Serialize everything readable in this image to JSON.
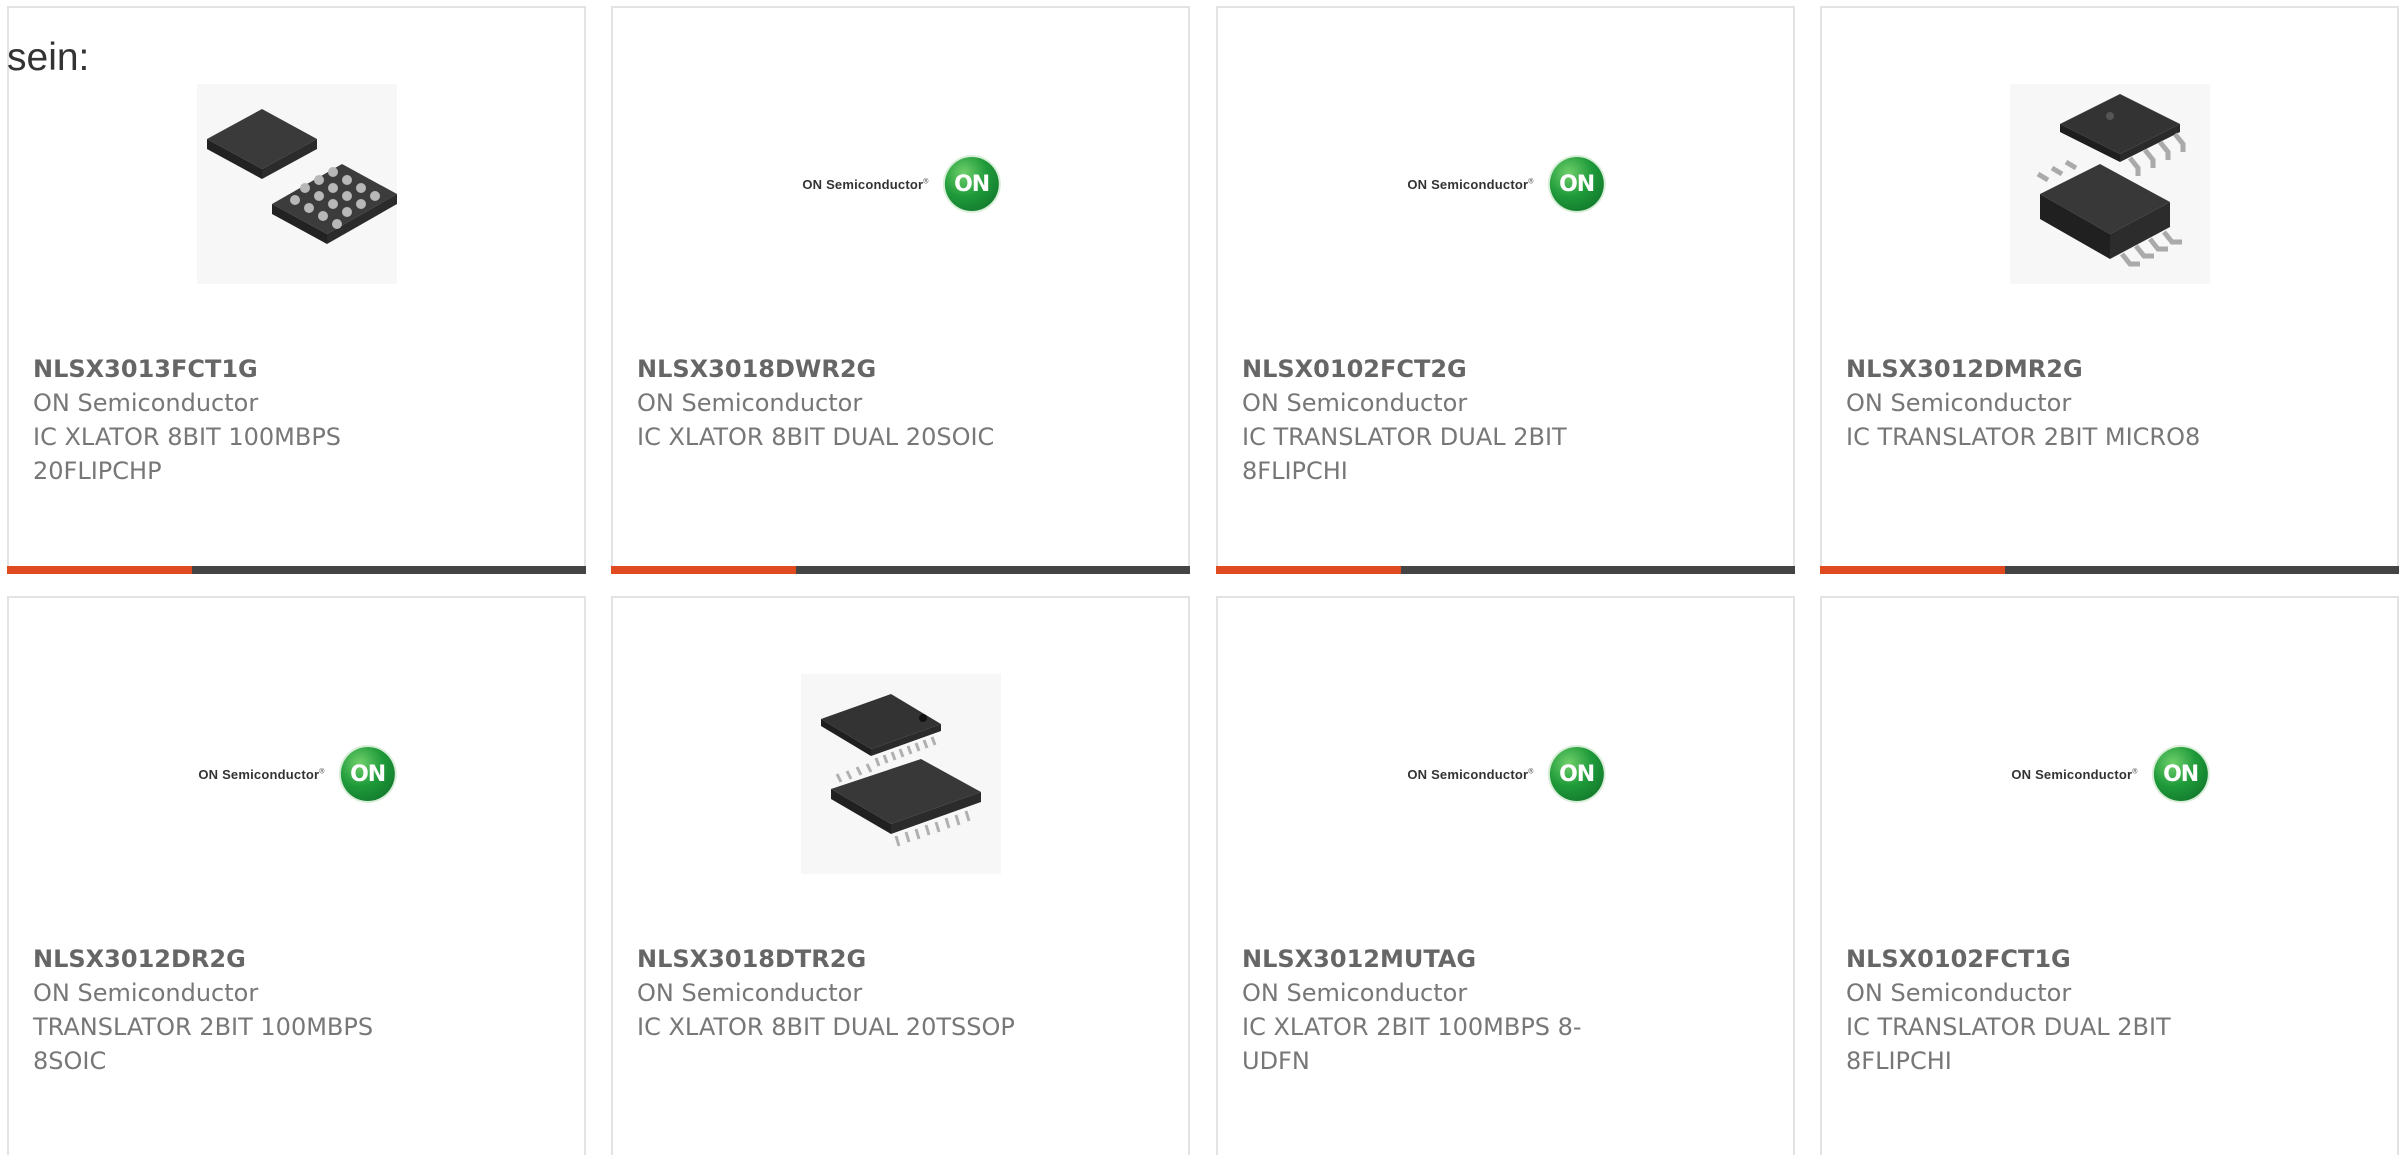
{
  "page": {
    "heading_prefix": "sein:"
  },
  "logo": {
    "wordmark": "ON Semiconductor",
    "registered": "®",
    "badge": "ON"
  },
  "colors": {
    "accent": "#e04a1f",
    "bar": "#444444",
    "on_green": "#1f9a3a"
  },
  "products": [
    {
      "part": "NLSX3013FCT1G",
      "manufacturer": "ON Semiconductor",
      "description_line1": "IC XLATOR 8BIT 100MBPS",
      "description_line2": "20FLIPCHP",
      "image": "bga-chip-icon"
    },
    {
      "part": "NLSX3018DWR2G",
      "manufacturer": "ON Semiconductor",
      "description_line1": "IC XLATOR 8BIT DUAL 20SOIC",
      "description_line2": "",
      "image": "on-semiconductor-logo"
    },
    {
      "part": "NLSX0102FCT2G",
      "manufacturer": "ON Semiconductor",
      "description_line1": "IC TRANSLATOR DUAL 2BIT",
      "description_line2": "8FLIPCHI",
      "image": "on-semiconductor-logo"
    },
    {
      "part": "NLSX3012DMR2G",
      "manufacturer": "ON Semiconductor",
      "description_line1": "IC TRANSLATOR 2BIT MICRO8",
      "description_line2": "",
      "image": "msop-chip-icon"
    },
    {
      "part": "NLSX3012DR2G",
      "manufacturer": "ON Semiconductor",
      "description_line1": "TRANSLATOR 2BIT 100MBPS",
      "description_line2": "8SOIC",
      "image": "on-semiconductor-logo"
    },
    {
      "part": "NLSX3018DTR2G",
      "manufacturer": "ON Semiconductor",
      "description_line1": "IC XLATOR 8BIT DUAL 20TSSOP",
      "description_line2": "",
      "image": "tssop-chip-icon"
    },
    {
      "part": "NLSX3012MUTAG",
      "manufacturer": "ON Semiconductor",
      "description_line1": "IC XLATOR 2BIT 100MBPS 8-",
      "description_line2": "UDFN",
      "image": "on-semiconductor-logo"
    },
    {
      "part": "NLSX0102FCT1G",
      "manufacturer": "ON Semiconductor",
      "description_line1": "IC TRANSLATOR DUAL 2BIT",
      "description_line2": "8FLIPCHI",
      "image": "on-semiconductor-logo"
    }
  ]
}
